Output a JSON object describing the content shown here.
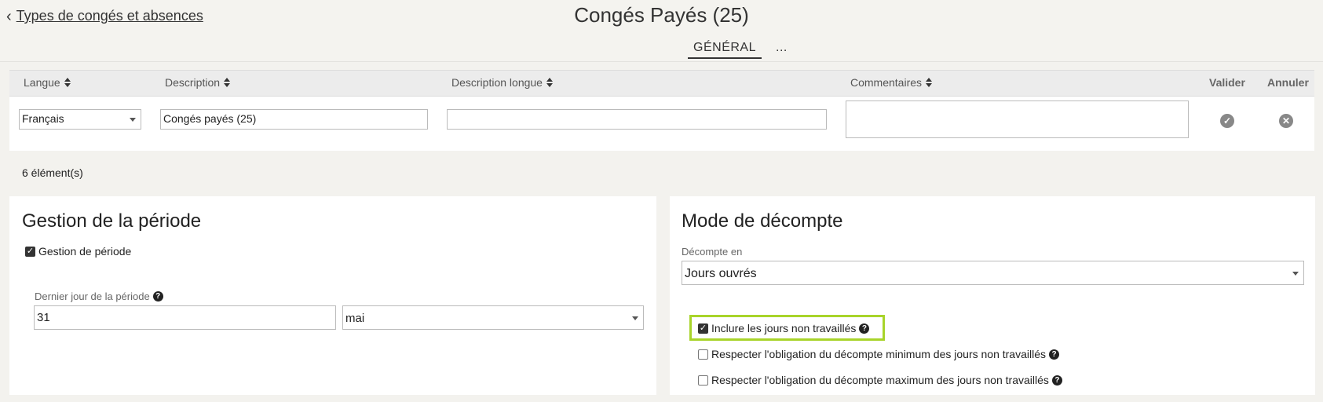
{
  "header": {
    "back_label": "Types de congés et absences",
    "title": "Congés Payés (25)",
    "tabs": [
      {
        "label": "GÉNÉRAL",
        "active": true
      },
      {
        "label": "..."
      }
    ]
  },
  "translations": {
    "columns": {
      "langue": "Langue",
      "description": "Description",
      "description_longue": "Description longue",
      "commentaires": "Commentaires",
      "valider": "Valider",
      "annuler": "Annuler"
    },
    "row": {
      "langue": "Français",
      "description": "Congés payés (25)",
      "description_longue": "",
      "commentaires": ""
    }
  },
  "count_label": "6 élément(s)",
  "periode": {
    "title": "Gestion de la période",
    "gestion_checkbox": {
      "label": "Gestion de période",
      "checked": true
    },
    "dernier_jour_label": "Dernier jour de la période",
    "jour_value": "31",
    "mois_value": "mai"
  },
  "decompte": {
    "title": "Mode de décompte",
    "decompte_en_label": "Décompte en",
    "decompte_en_value": "Jours ouvrés",
    "options": [
      {
        "label": "Inclure les jours non travaillés",
        "checked": true,
        "highlighted": true
      },
      {
        "label": "Respecter l'obligation du décompte minimum des jours non travaillés",
        "checked": false
      },
      {
        "label": "Respecter l'obligation du décompte maximum des jours non travaillés",
        "checked": false
      }
    ]
  },
  "colors": {
    "highlight": "#a8d42a",
    "background": "#f3f2ee",
    "header_bg": "#ececec"
  }
}
